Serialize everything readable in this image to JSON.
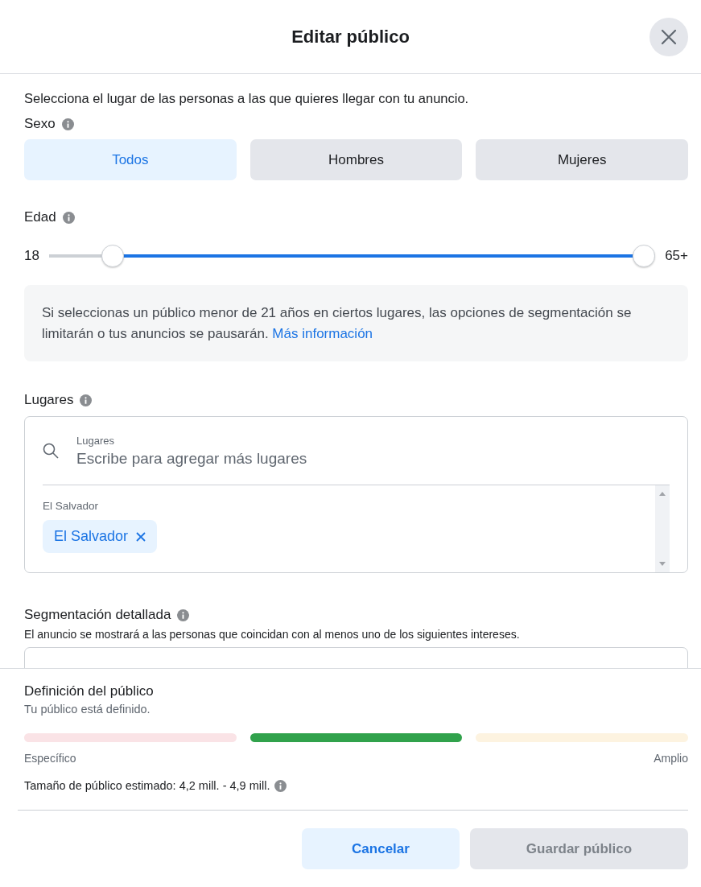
{
  "dialog": {
    "title": "Editar público"
  },
  "intro": "Selecciona el lugar de las personas a las que quieres llegar con tu anuncio.",
  "gender": {
    "label": "Sexo",
    "options": [
      {
        "label": "Todos",
        "selected": true
      },
      {
        "label": "Hombres",
        "selected": false
      },
      {
        "label": "Mujeres",
        "selected": false
      }
    ]
  },
  "age": {
    "label": "Edad",
    "min_label": "18",
    "max_label": "65+",
    "thumbs": [
      {
        "level": 0.09
      },
      {
        "level": 1
      }
    ]
  },
  "notice": {
    "text": "Si seleccionas un público menor de 21 años en ciertos lugares, las opciones de segmentación se limitarán o tus anuncios se pausarán.",
    "link": "Más información"
  },
  "locations": {
    "label": "Lugares",
    "search": {
      "label": "Lugares",
      "placeholder": "Escribe para agregar más lugares"
    },
    "group_label": "El Salvador",
    "tags": [
      "El Salvador"
    ]
  },
  "detailed_targeting": {
    "label": "Segmentación detallada",
    "description": "El anuncio se mostrará a las personas que coincidan con al menos uno de los siguientes intereses."
  },
  "audience_definition": {
    "title": "Definición del público",
    "status": "Tu público está definido.",
    "segments": [
      {
        "color": "#fae3e6"
      },
      {
        "color": "#31a24c"
      },
      {
        "color": "#fdf3e0"
      }
    ],
    "min_label": "Específico",
    "max_label": "Amplio",
    "estimate": "Tamaño de público estimado: 4,2 mill. - 4,9 mill."
  },
  "buttons": [
    {
      "label": "Cancelar",
      "kind": "secondary",
      "disabled": false
    },
    {
      "label": "Guardar público",
      "kind": "primary",
      "disabled": true
    }
  ]
}
